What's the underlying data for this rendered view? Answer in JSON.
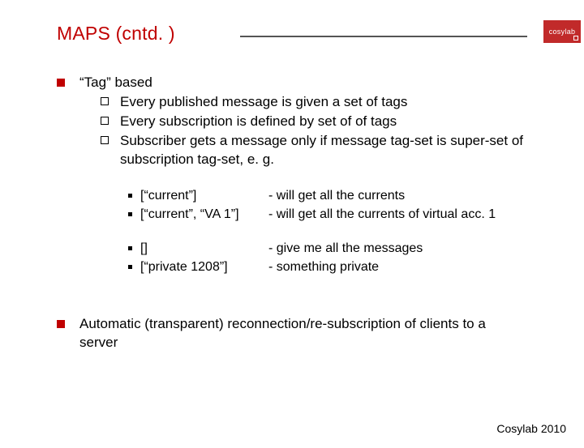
{
  "brand": {
    "name": "cosylab"
  },
  "title": "MAPS (cntd. )",
  "main": {
    "p1": {
      "head": "“Tag” based",
      "sub": [
        "Every published message is given a set of tags",
        "Every subscription is defined by set of of tags",
        "Subscriber gets a message only if message tag-set is super-set of subscription tag-set, e. g."
      ],
      "examples": [
        [
          {
            "left": "[“current”]",
            "right": "- will get all the currents"
          },
          {
            "left": "[“current”, “VA 1”]",
            "right": "- will get all the currents of virtual acc. 1"
          }
        ],
        [
          {
            "left": "[]",
            "right": "- give me all the messages"
          },
          {
            "left": "[“private 1208”]",
            "right": "- something private"
          }
        ]
      ]
    },
    "p2": "Automatic (transparent) reconnection/re-subscription of clients to a server"
  },
  "footer": "Cosylab 2010"
}
